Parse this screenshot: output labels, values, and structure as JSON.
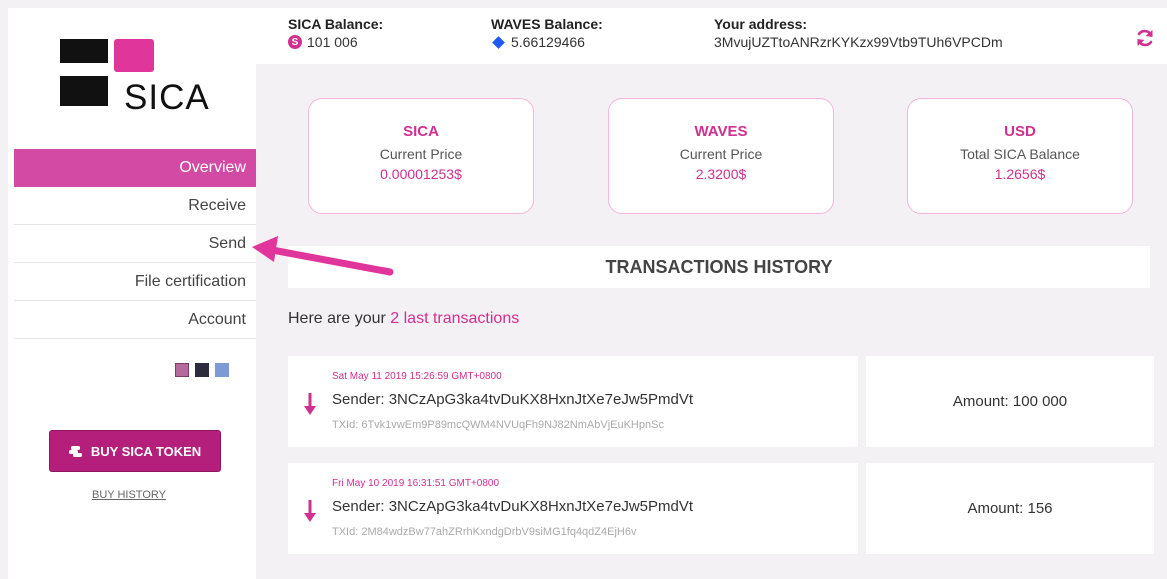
{
  "brand": {
    "name": "SICA"
  },
  "nav": {
    "items": [
      {
        "label": "Overview",
        "active": true
      },
      {
        "label": "Receive",
        "active": false
      },
      {
        "label": "Send",
        "active": false
      },
      {
        "label": "File certification",
        "active": false
      },
      {
        "label": "Account",
        "active": false
      }
    ]
  },
  "theme_swatches": [
    "#b46b9c",
    "#2c2c3e",
    "#7b9ad6"
  ],
  "buy": {
    "button_label": "BUY SICA TOKEN",
    "history_link": "BUY HISTORY"
  },
  "balances": {
    "sica_label": "SICA Balance:",
    "sica_value": "101 006",
    "waves_label": "WAVES Balance:",
    "waves_value": "5.66129466",
    "address_label": "Your address:",
    "address_value": "3MvujUZTtoANRzrKYKzx99Vtb9TUh6VPCDm"
  },
  "cards": [
    {
      "title": "SICA",
      "subtitle": "Current Price",
      "value": "0.00001253$"
    },
    {
      "title": "WAVES",
      "subtitle": "Current Price",
      "value": "2.3200$"
    },
    {
      "title": "USD",
      "subtitle": "Total SICA Balance",
      "value": "1.2656$"
    }
  ],
  "transactions": {
    "heading": "TRANSACTIONS HISTORY",
    "intro_prefix": "Here are your ",
    "intro_highlight": "2 last transactions",
    "items": [
      {
        "date": "Sat May 11 2019 15:26:59 GMT+0800",
        "sender": "Sender: 3NCzApG3ka4tvDuKX8HxnJtXe7eJw5PmdVt",
        "txid": "TXId: 6Tvk1vwEm9P89mcQWM4NVUqFh9NJ82NmAbVjEuKHpnSc",
        "amount": "Amount: 100 000"
      },
      {
        "date": "Fri May 10 2019 16:31:51 GMT+0800",
        "sender": "Sender: 3NCzApG3ka4tvDuKX8HxnJtXe7eJw5PmdVt",
        "txid": "TXId: 2M84wdzBw77ahZRrhKxndgDrbV9siMG1fq4qdZ4EjH6v",
        "amount": "Amount: 156"
      }
    ]
  },
  "colors": {
    "accent": "#d0308f",
    "nav_active": "#d24aa4",
    "button": "#b31f7a",
    "waves": "#1f5af6"
  },
  "icons": {
    "refresh": "refresh-icon",
    "sica_coin": "sica-coin-icon",
    "waves": "waves-diamond-icon",
    "incoming": "arrow-down-icon",
    "buy": "coins-icon"
  }
}
